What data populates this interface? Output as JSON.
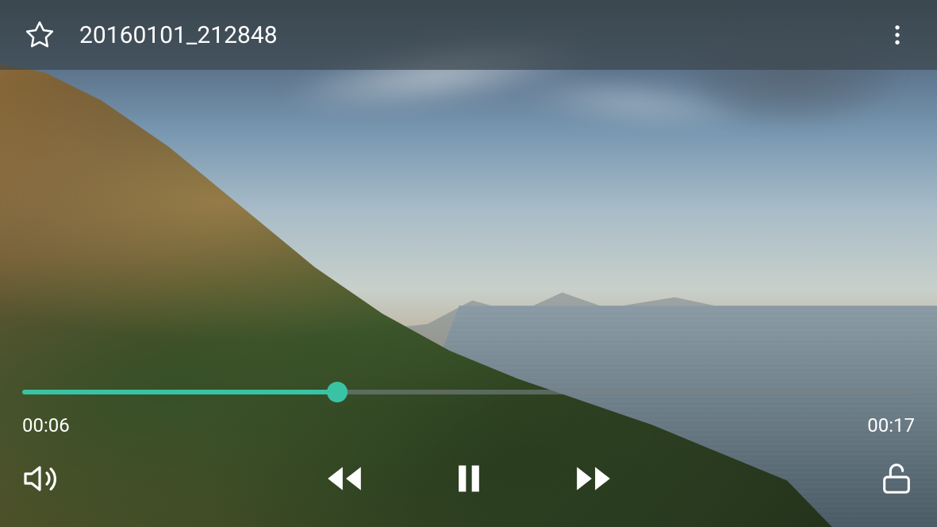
{
  "header": {
    "title": "20160101_212848"
  },
  "playback": {
    "current_time": "00:06",
    "duration": "00:17",
    "progress_percent": 35.3
  },
  "colors": {
    "accent": "#3ac2a5"
  },
  "icons": {
    "favorite": "star-outline",
    "more": "more-vertical",
    "volume": "volume",
    "rewind": "rewind",
    "play_pause": "pause",
    "forward": "fast-forward",
    "lock": "unlock"
  }
}
